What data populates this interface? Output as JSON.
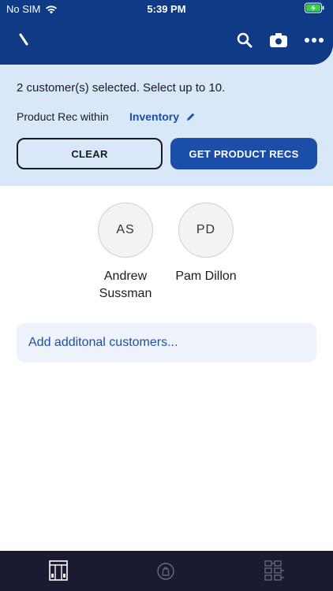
{
  "status_bar": {
    "carrier": "No SIM",
    "time": "5:39 PM"
  },
  "selection_panel": {
    "message": "2 customer(s) selected. Select up to 10.",
    "rec_within_label": "Product Rec within",
    "rec_within_value": "Inventory",
    "clear_label": "CLEAR",
    "get_recs_label": "GET PRODUCT RECS"
  },
  "customers": [
    {
      "initials": "AS",
      "name": "Andrew Sussman"
    },
    {
      "initials": "PD",
      "name": "Pam Dillon"
    }
  ],
  "add_customers_label": "Add additonal customers...",
  "colors": {
    "navbar": "#0f3a86",
    "panel": "#d8e8f8",
    "accent": "#1a4ea8",
    "tabbar": "#1a1b33"
  },
  "icons": {
    "nav": [
      "back-icon",
      "search-icon",
      "camera-icon",
      "more-icon"
    ],
    "tabs": [
      "storefront-icon",
      "product-bag-icon",
      "hierarchy-icon"
    ]
  }
}
